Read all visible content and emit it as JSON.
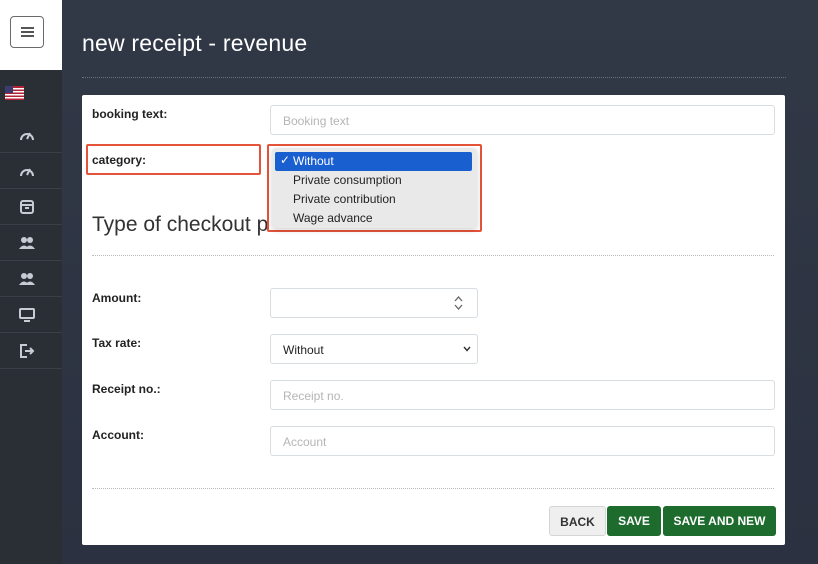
{
  "sidebar": {
    "icons": [
      "menu-icon",
      "us-flag-icon",
      "speedometer-icon",
      "speedometer-icon",
      "archive-box-icon",
      "users-icon",
      "users-icon",
      "monitor-icon",
      "logout-icon"
    ]
  },
  "page": {
    "title": "new receipt - revenue"
  },
  "form": {
    "booking_text_label": "booking text:",
    "booking_text_placeholder": "Booking text",
    "category_label": "category:",
    "section_heading": "Type of checkout p",
    "amount_label": "Amount:",
    "tax_rate_label": "Tax rate:",
    "tax_rate_value": "Without",
    "receipt_no_label": "Receipt no.:",
    "receipt_no_placeholder": "Receipt no.",
    "account_label": "Account:",
    "account_placeholder": "Account"
  },
  "category_dropdown": {
    "options": [
      "Without",
      "Private consumption",
      "Private contribution",
      "Wage advance"
    ],
    "selected": "Without",
    "check": "✓"
  },
  "buttons": {
    "back": "BACK",
    "save": "SAVE",
    "save_and_new": "SAVE AND NEW"
  },
  "colors": {
    "highlight": "#e5533a",
    "primary_green": "#1e6b2e",
    "selection_blue": "#1a5fd0"
  }
}
